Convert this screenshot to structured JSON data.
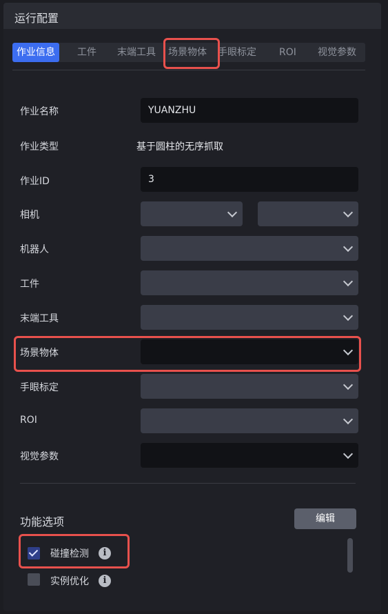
{
  "header": {
    "title": "运行配置"
  },
  "tabs": [
    {
      "label": "作业信息",
      "active": true
    },
    {
      "label": "工件"
    },
    {
      "label": "末端工具"
    },
    {
      "label": "场景物体"
    },
    {
      "label": "手眼标定"
    },
    {
      "label": "ROI"
    },
    {
      "label": "视觉参数"
    }
  ],
  "form": {
    "job_name_label": "作业名称",
    "job_name_value": "YUANZHU",
    "job_type_label": "作业类型",
    "job_type_value": "基于圆柱的无序抓取",
    "job_id_label": "作业ID",
    "job_id_value": "3",
    "camera_label": "相机",
    "robot_label": "机器人",
    "workpiece_label": "工件",
    "end_tool_label": "末端工具",
    "scene_object_label": "场景物体",
    "hand_eye_label": "手眼标定",
    "roi_label": "ROI",
    "vision_params_label": "视觉参数"
  },
  "options": {
    "title": "功能选项",
    "edit_label": "编辑",
    "items": [
      {
        "label": "碰撞检测",
        "checked": true
      },
      {
        "label": "实例优化",
        "checked": false
      }
    ]
  },
  "colors": {
    "accent": "#3c6df0",
    "highlight": "#e8514d",
    "background": "#1f2026"
  }
}
